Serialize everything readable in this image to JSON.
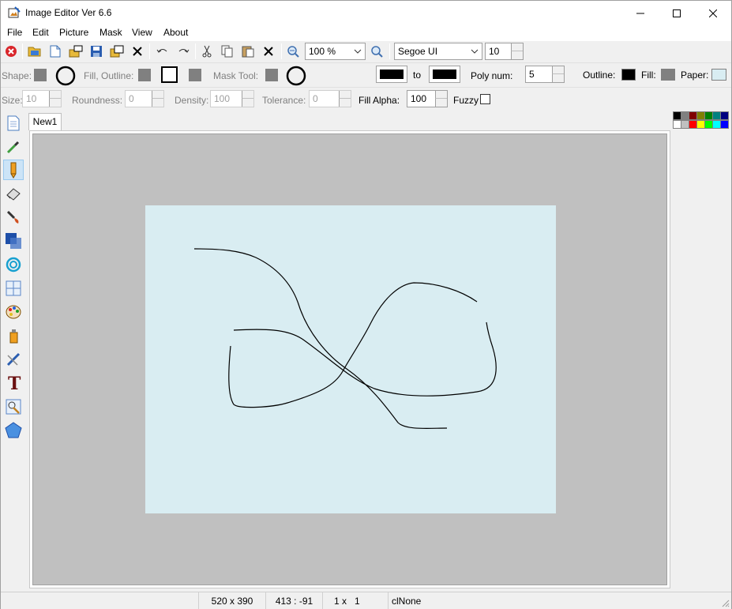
{
  "window": {
    "title": "Image Editor Ver 6.6"
  },
  "menu": [
    "File",
    "Edit",
    "Picture",
    "Mask",
    "View",
    "About"
  ],
  "toolbar": {
    "zoom_value": "100 %",
    "font_name": "Segoe UI",
    "font_size": "10",
    "icons": [
      "close-red-icon",
      "open-folder-icon",
      "new-document-icon",
      "import-icon",
      "save-icon",
      "save-as-icon",
      "delete-icon",
      "undo-icon",
      "redo-icon",
      "cut-icon",
      "copy-icon",
      "paste-icon",
      "clear-icon",
      "zoom-out-icon",
      "zoom-in-icon"
    ]
  },
  "options_row1": {
    "shape_label": "Shape:",
    "fill_outline_label": "Fill, Outline:",
    "mask_tool_label": "Mask Tool:",
    "to_label": "to",
    "poly_num_label": "Poly num:",
    "poly_num_value": "5",
    "outline_label": "Outline:",
    "fill_label": "Fill:",
    "paper_label": "Paper:",
    "colors": {
      "gradient_from": "#000000",
      "gradient_to": "#000000",
      "outline": "#000000",
      "fill": "#808080",
      "paper": "#d9edf2"
    }
  },
  "options_row2": {
    "size_label": "Size:",
    "size_value": "10",
    "roundness_label": "Roundness:",
    "roundness_value": "0",
    "density_label": "Density:",
    "density_value": "100",
    "tolerance_label": "Tolerance:",
    "tolerance_value": "0",
    "fill_alpha_label": "Fill Alpha:",
    "fill_alpha_value": "100",
    "fuzzy_label": "Fuzzy"
  },
  "tools": [
    "new-image-icon",
    "eyedropper-icon",
    "pencil-icon",
    "eraser-icon",
    "brush-icon",
    "rectangle-shape-icon",
    "circle-shape-icon",
    "grid-icon",
    "color-palette-icon",
    "spray-can-icon",
    "line-icon",
    "text-icon",
    "magic-wand-icon",
    "polygon-icon"
  ],
  "selected_tool": "pencil-icon",
  "tab": {
    "label": "New1"
  },
  "palette": {
    "row1": [
      "#000000",
      "#808080",
      "#800000",
      "#808000",
      "#008000",
      "#008080",
      "#000080"
    ],
    "row2": [
      "#ffffff",
      "#c0c0c0",
      "#ff0000",
      "#ffff00",
      "#00ff00",
      "#00ffff",
      "#0000ff"
    ]
  },
  "status": {
    "dimensions": "520 x 390",
    "cursor": "413 : -91",
    "scale": "1 x   1",
    "color": "clNone"
  }
}
